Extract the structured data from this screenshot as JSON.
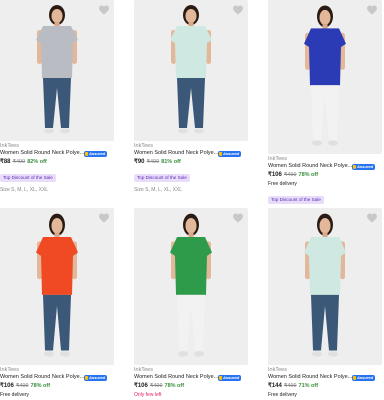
{
  "products": [
    {
      "brand": "InkTees",
      "title": "Women Solid Round Neck Polye...",
      "assured": "Assured",
      "price": "₹88",
      "mrp": "₹499",
      "discount": "82% off",
      "tag": "Top Discount of the Sale",
      "extra": "",
      "size": "Size S, M, L, XL, XXL",
      "shirt_color": "#b9bcc2",
      "pants_color": "#3b5878",
      "bg": "#eeeeee"
    },
    {
      "brand": "InkTees",
      "title": "Women Solid Round Neck Polye...",
      "assured": "Assured",
      "price": "₹90",
      "mrp": "₹499",
      "discount": "81% off",
      "tag": "Top Discount of the Sale",
      "extra": "",
      "size": "Size S, M, L, XL, XXL",
      "shirt_color": "#cfe8e2",
      "pants_color": "#3b5878",
      "bg": "#eeeeee"
    },
    {
      "brand": "InkTees",
      "title": "Women Solid Round Neck Polye...",
      "assured": "Assured",
      "price": "₹106",
      "mrp": "₹499",
      "discount": "78% off",
      "tag": "Top Discount of the Sale",
      "extra": "Free delivery",
      "size": "",
      "shirt_color": "#2b3bb5",
      "pants_color": "#f2f2f2",
      "bg": "#eeeeee"
    },
    {
      "brand": "InkTees",
      "title": "Women Solid Round Neck Polye...",
      "assured": "Assured",
      "price": "₹106",
      "mrp": "₹499",
      "discount": "78% off",
      "tag": "",
      "extra": "Free delivery",
      "size": "",
      "shirt_color": "#f04a25",
      "pants_color": "#3b5878",
      "bg": "#eeeeee"
    },
    {
      "brand": "InkTees",
      "title": "Women Solid Round Neck Polye...",
      "assured": "Assured",
      "price": "₹106",
      "mrp": "₹499",
      "discount": "78% off",
      "tag": "",
      "extra": "",
      "only_left": "Only few left",
      "size": "",
      "shirt_color": "#2e9b4a",
      "pants_color": "#f2f2f2",
      "bg": "#eeeeee"
    },
    {
      "brand": "InkTees",
      "title": "Women Solid Round Neck Polye...",
      "assured": "Assured",
      "price": "₹144",
      "mrp": "₹499",
      "discount": "71% off",
      "tag": "",
      "extra": "Free delivery",
      "size": "",
      "shirt_color": "#cfe8e2",
      "pants_color": "#3b5878",
      "bg": "#eeeeee"
    }
  ]
}
